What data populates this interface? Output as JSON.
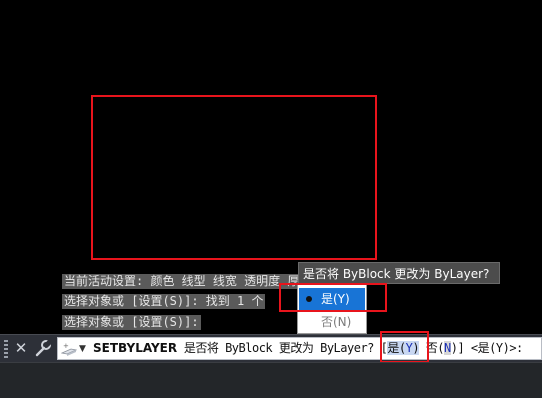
{
  "history": {
    "line1": "当前活动设置: 颜色 线型 线宽 透明度 厚度",
    "line2": "选择对象或 [设置(S)]: 找到 1 个",
    "line3": "选择对象或 [设置(S)]:"
  },
  "context_menu": {
    "title": "是否将 ByBlock 更改为 ByLayer?",
    "items": [
      {
        "label": "是(Y)",
        "selected": true
      },
      {
        "label": "否(N)",
        "selected": false
      }
    ]
  },
  "command_line": {
    "command": "SETBYLAYER",
    "prompt_text": " 是否将 ByBlock 更改为 ByLayer? [",
    "option_yes_prefix": "是(",
    "option_yes_key": "Y",
    "option_yes_suffix": ")",
    "option_no_prefix": " 否(",
    "option_no_key": "N",
    "option_no_suffix": ")",
    "prompt_end": "] <是(Y)>:"
  },
  "icons": {
    "close": "close-icon",
    "customize": "wrench-icon",
    "command_prompt": "command-prompt-icon",
    "recent": "chevron-down-icon"
  },
  "colors": {
    "canvas": "#000000",
    "highlight_red": "#e8141c",
    "menu_selected": "#1874d6",
    "option_blue": "#1a2fb5"
  }
}
